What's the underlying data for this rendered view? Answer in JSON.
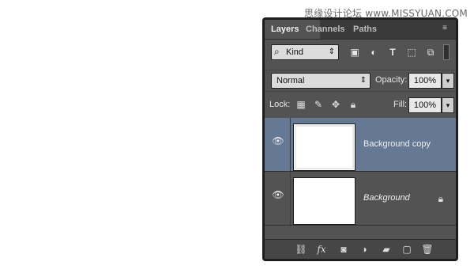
{
  "watermark": {
    "text": "思缘设计论坛 www.MISSYUAN.COM"
  },
  "panel": {
    "tabs": [
      {
        "label": "Layers",
        "active": true
      },
      {
        "label": "Channels",
        "active": false
      },
      {
        "label": "Paths",
        "active": false
      }
    ],
    "filter": {
      "kind_label": "Kind",
      "icons": [
        "pixel-filter-icon",
        "adjustment-filter-icon",
        "type-filter-icon",
        "shape-filter-icon",
        "smart-object-filter-icon"
      ]
    },
    "blend": {
      "mode": "Normal",
      "opacity_label": "Opacity:",
      "opacity_value": "100%"
    },
    "lock": {
      "label": "Lock:",
      "fill_label": "Fill:",
      "fill_value": "100%"
    },
    "layers": [
      {
        "name": "Background copy",
        "selected": true,
        "italic": false,
        "locked": false
      },
      {
        "name": "Background",
        "selected": false,
        "italic": true,
        "locked": true
      }
    ],
    "bottom_icons": [
      "link-layers-icon",
      "fx-icon",
      "mask-icon",
      "adjustment-icon",
      "folder-icon",
      "new-layer-icon",
      "trash-icon"
    ],
    "colors": {
      "panel_bg": "#535353",
      "selected_layer": "#657894",
      "tab_bar": "#3a3a3a"
    }
  }
}
